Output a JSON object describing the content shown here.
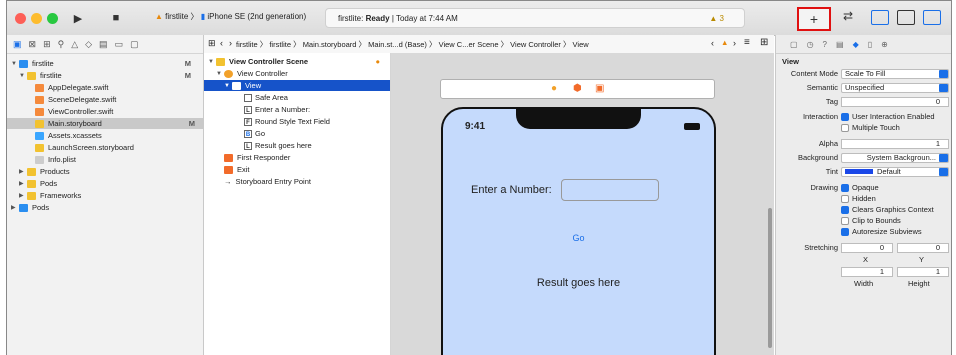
{
  "toolbar": {
    "scheme_app": "firstlite",
    "scheme_device": "iPhone SE (2nd generation)",
    "status_app": "firstlite:",
    "status_state": "Ready",
    "status_time": "Today at 7:44 AM",
    "warning_count": "3",
    "library_button": "+"
  },
  "navigator": {
    "items": [
      {
        "label": "firstlite",
        "badge": "M"
      },
      {
        "label": "firstlite",
        "badge": "M"
      },
      {
        "label": "AppDelegate.swift"
      },
      {
        "label": "SceneDelegate.swift"
      },
      {
        "label": "ViewController.swift"
      },
      {
        "label": "Main.storyboard",
        "badge": "M"
      },
      {
        "label": "Assets.xcassets"
      },
      {
        "label": "LaunchScreen.storyboard"
      },
      {
        "label": "Info.plist"
      },
      {
        "label": "Products"
      },
      {
        "label": "Pods"
      },
      {
        "label": "Frameworks"
      },
      {
        "label": "Pods"
      }
    ]
  },
  "jumpbar": {
    "crumbs": [
      "firstlite",
      "firstlite",
      "Main.storyboard",
      "Main.st...d (Base)",
      "View C...er Scene",
      "View Controller",
      "View"
    ]
  },
  "outline": {
    "items": [
      "View Controller Scene",
      "View Controller",
      "View",
      "Safe Area",
      "Enter a Number:",
      "Round Style Text Field",
      "Go",
      "Result goes here",
      "First Responder",
      "Exit",
      "Storyboard Entry Point"
    ]
  },
  "canvas": {
    "clock": "9:41",
    "enter_label": "Enter a Number:",
    "go_button": "Go",
    "result_label": "Result goes here"
  },
  "inspector": {
    "section": "View",
    "content_mode_label": "Content Mode",
    "content_mode": "Scale To Fill",
    "semantic_label": "Semantic",
    "semantic": "Unspecified",
    "tag_label": "Tag",
    "tag": "0",
    "interaction_label": "Interaction",
    "user_interaction": "User Interaction Enabled",
    "multiple_touch": "Multiple Touch",
    "alpha_label": "Alpha",
    "alpha": "1",
    "background_label": "Background",
    "background": "System Backgroun...",
    "tint_label": "Tint",
    "tint": "Default",
    "drawing_label": "Drawing",
    "opaque": "Opaque",
    "hidden": "Hidden",
    "clears_graphics": "Clears Graphics Context",
    "clip_bounds": "Clip to Bounds",
    "autoresize": "Autoresize Subviews",
    "stretching_label": "Stretching",
    "stretch_x": "0",
    "stretch_y": "0",
    "stretch_w": "1",
    "stretch_h": "1",
    "x_lbl": "X",
    "y_lbl": "Y",
    "w_lbl": "Width",
    "h_lbl": "Height"
  },
  "colors": {
    "accent": "#1a6fe8",
    "selection": "#1653c9",
    "library_highlight": "#e01010"
  }
}
